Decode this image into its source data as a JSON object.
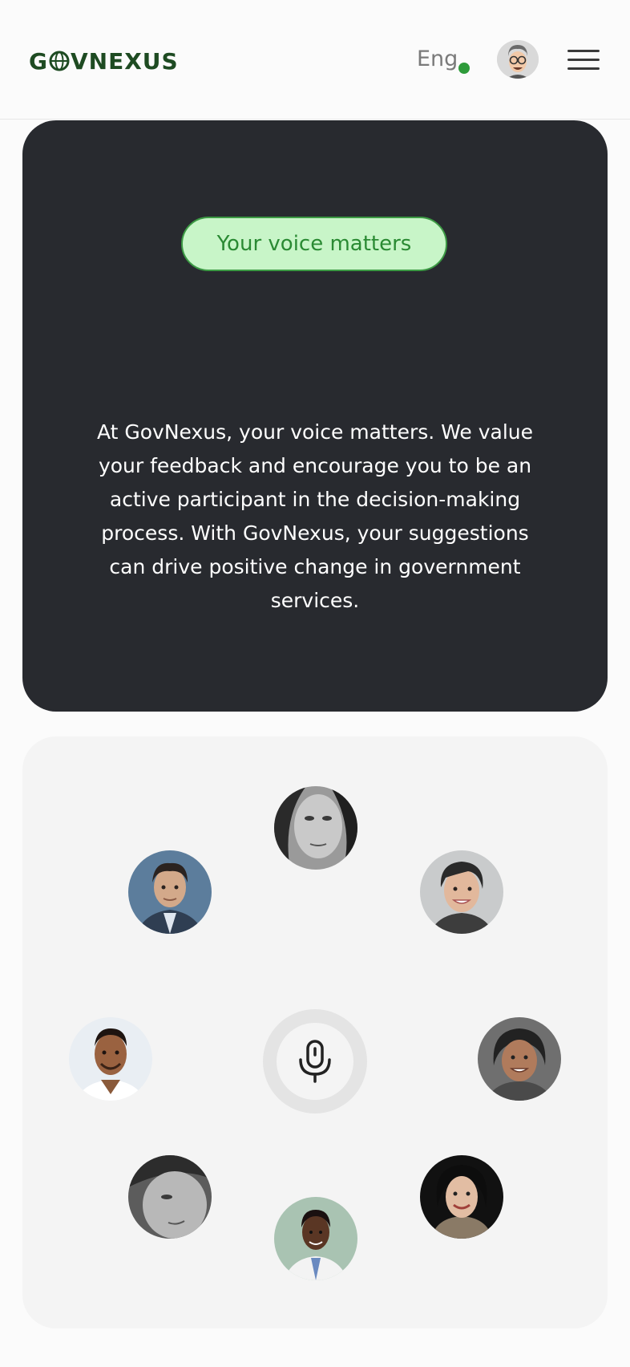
{
  "header": {
    "logo_text": "GOVNEXUS",
    "logo_prefix": "G",
    "logo_suffix": "VNEXUS",
    "language": "Eng",
    "status_color": "#2e9b3a"
  },
  "hero": {
    "badge": "Your voice matters",
    "body": "At GovNexus, your voice matters. We value your feedback and encourage you to be an active participant in the decision-making process. With GovNexus, your suggestions can drive positive change in government services."
  },
  "voices": {
    "center_icon": "microphone-icon",
    "participants": [
      {
        "name": "participant-avatar-1"
      },
      {
        "name": "participant-avatar-2"
      },
      {
        "name": "participant-avatar-3"
      },
      {
        "name": "participant-avatar-4"
      },
      {
        "name": "participant-avatar-5"
      },
      {
        "name": "participant-avatar-6"
      },
      {
        "name": "participant-avatar-7"
      },
      {
        "name": "participant-avatar-8"
      }
    ]
  },
  "colors": {
    "brand_green": "#1e4b22",
    "accent_green": "#2a8a33",
    "badge_bg": "#c8f5c8",
    "hero_bg": "#282a2f"
  }
}
